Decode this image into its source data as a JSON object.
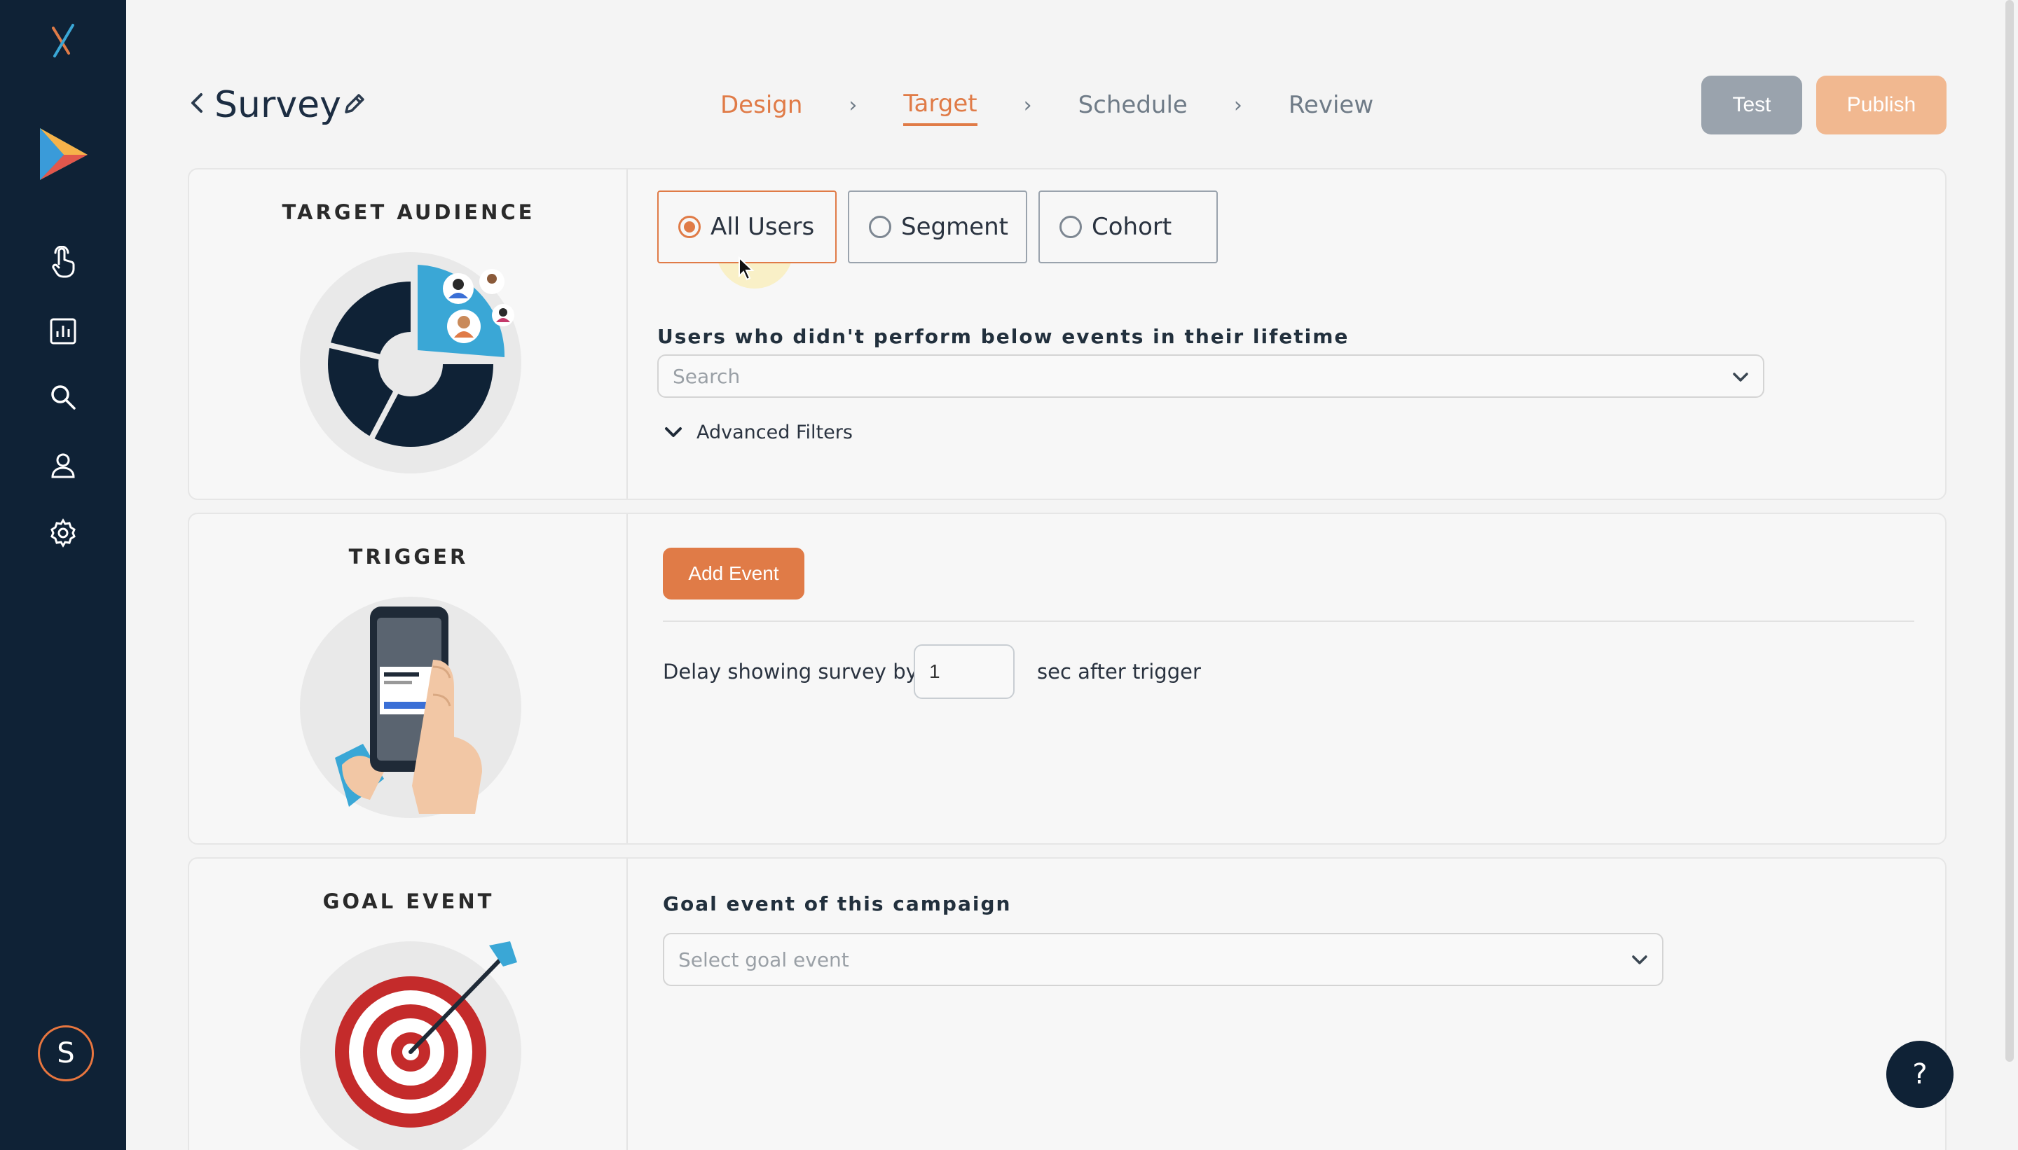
{
  "header": {
    "back_icon": "chevron-left-icon",
    "title": "Survey",
    "edit_icon": "pencil-icon",
    "steps": [
      {
        "label": "Design",
        "state": "done"
      },
      {
        "label": "Target",
        "state": "active"
      },
      {
        "label": "Schedule",
        "state": "pending"
      },
      {
        "label": "Review",
        "state": "pending"
      }
    ],
    "step_separator_icon": "chevron-right-icon",
    "test_label": "Test",
    "publish_label": "Publish"
  },
  "sidebar": {
    "items": [
      {
        "icon": "logo-icon"
      },
      {
        "icon": "play-triangle-icon"
      },
      {
        "icon": "tap-gesture-icon"
      },
      {
        "icon": "bar-chart-icon"
      },
      {
        "icon": "search-icon"
      },
      {
        "icon": "user-icon"
      },
      {
        "icon": "gear-icon"
      }
    ],
    "avatar_letter": "S"
  },
  "target_audience": {
    "title": "TARGET AUDIENCE",
    "options": [
      {
        "label": "All Users",
        "selected": true
      },
      {
        "label": "Segment",
        "selected": false
      },
      {
        "label": "Cohort",
        "selected": false
      }
    ],
    "events_label": "Users who didn't perform below events in their lifetime",
    "search_placeholder": "Search",
    "advanced_filters_label": "Advanced Filters"
  },
  "trigger": {
    "title": "TRIGGER",
    "add_event_label": "Add Event",
    "delay_label": "Delay showing survey by",
    "delay_value": "1",
    "after_label": "sec after trigger"
  },
  "goal_event": {
    "title": "GOAL EVENT",
    "label": "Goal event of this campaign",
    "placeholder": "Select goal event"
  },
  "help_label": "?",
  "colors": {
    "sidebar_bg": "#0f2236",
    "accent": "#e07b47",
    "test_button": "#9aa3ad",
    "publish_button": "#f1b890",
    "page_bg": "#f4f4f4"
  }
}
